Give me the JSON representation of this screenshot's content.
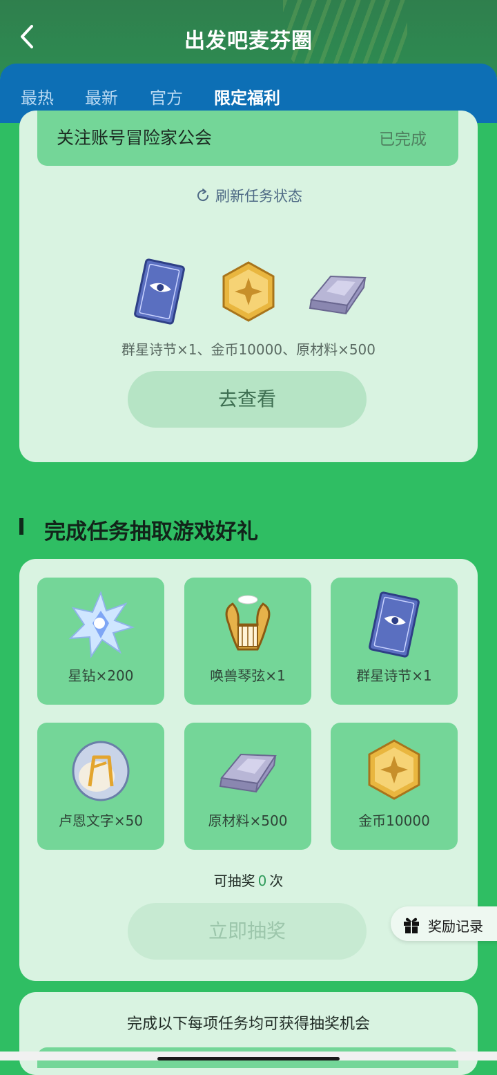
{
  "header": {
    "title": "出发吧麦芬圈"
  },
  "tabs": [
    {
      "label": "最热"
    },
    {
      "label": "最新"
    },
    {
      "label": "官方"
    },
    {
      "label": "限定福利"
    }
  ],
  "task_card": {
    "task_name": "关注账号冒险家公会",
    "task_status": "已完成",
    "refresh_label": "刷新任务状态",
    "reward_icons": [
      "tarot-card-icon",
      "gold-coin-icon",
      "metal-ingot-icon"
    ],
    "reward_text": "群星诗节×1、金币10000、原材料×500",
    "button_label": "去查看"
  },
  "lottery": {
    "section_title": "完成任务抽取游戏好礼",
    "prizes": [
      {
        "label": "星钻×200",
        "icon": "star-diamond-icon"
      },
      {
        "label": "唤兽琴弦×1",
        "icon": "lyre-icon"
      },
      {
        "label": "群星诗节×1",
        "icon": "tarot-card-icon"
      },
      {
        "label": "卢恩文字×50",
        "icon": "rune-orb-icon"
      },
      {
        "label": "原材料×500",
        "icon": "metal-ingot-icon"
      },
      {
        "label": "金币10000",
        "icon": "gold-coin-icon"
      }
    ],
    "chances_prefix": "可抽奖",
    "chances_count": "0",
    "chances_suffix": "次",
    "draw_button": "立即抽奖",
    "record_label": "奖励记录"
  },
  "next_card": {
    "title": "完成以下每项任务均可获得抽奖机会"
  },
  "colors": {
    "page_bg": "#2fbe63",
    "tab_bar": "#0d6fb5",
    "card_bg": "#d9f3e1",
    "tile_bg": "#74d698"
  }
}
